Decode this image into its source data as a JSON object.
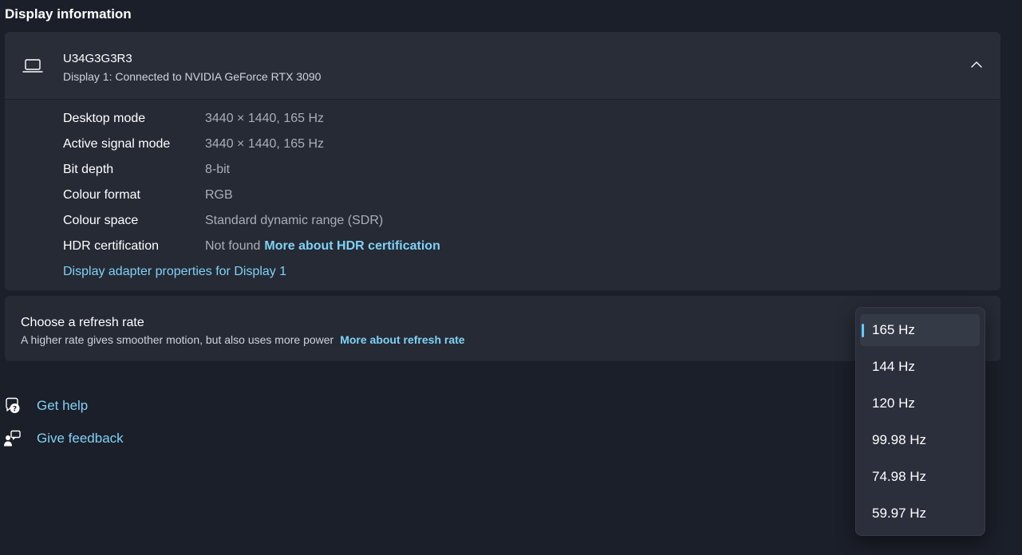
{
  "section_title": "Display information",
  "display": {
    "name": "U34G3G3R3",
    "subtitle": "Display 1: Connected to NVIDIA GeForce RTX 3090",
    "rows": [
      {
        "label": "Desktop mode",
        "value": "3440 × 1440, 165 Hz"
      },
      {
        "label": "Active signal mode",
        "value": "3440 × 1440, 165 Hz"
      },
      {
        "label": "Bit depth",
        "value": "8-bit"
      },
      {
        "label": "Colour format",
        "value": "RGB"
      },
      {
        "label": "Colour space",
        "value": "Standard dynamic range (SDR)"
      },
      {
        "label": "HDR certification",
        "value": "Not found",
        "link": "More about HDR certification"
      }
    ],
    "adapter_link": "Display adapter properties for Display 1"
  },
  "refresh": {
    "title": "Choose a refresh rate",
    "description": "A higher rate gives smoother motion, but also uses more power",
    "link": "More about refresh rate",
    "selected": "165 Hz",
    "options": [
      "165 Hz",
      "144 Hz",
      "120 Hz",
      "99.98 Hz",
      "74.98 Hz",
      "59.97 Hz"
    ]
  },
  "help": {
    "get_help": "Get help",
    "give_feedback": "Give feedback"
  },
  "colors": {
    "background": "#1b1f29",
    "card": "#252a35",
    "accent": "#60cdff",
    "link": "#7fd2f5"
  },
  "icons": {
    "display": "laptop-icon",
    "collapse": "chevron-up-icon",
    "get_help": "help-chat-icon",
    "give_feedback": "feedback-person-icon"
  }
}
